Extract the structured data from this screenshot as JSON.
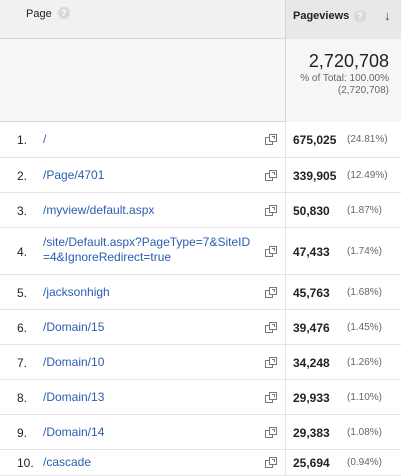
{
  "header": {
    "page_label": "Page",
    "pageviews_label": "Pageviews",
    "help_glyph": "?",
    "sort_glyph": "↓"
  },
  "totals": {
    "value": "2,720,708",
    "pct_of_total": "% of Total: 100.00%",
    "abs": "(2,720,708)"
  },
  "rows": [
    {
      "rank": "1.",
      "page": "/",
      "pageviews": "675,025",
      "pct": "(24.81%)"
    },
    {
      "rank": "2.",
      "page": "/Page/4701",
      "pageviews": "339,905",
      "pct": "(12.49%)"
    },
    {
      "rank": "3.",
      "page": "/myview/default.aspx",
      "pageviews": "50,830",
      "pct": "(1.87%)"
    },
    {
      "rank": "4.",
      "page": "/site/Default.aspx?PageType=7&SiteID=4&IgnoreRedirect=true",
      "pageviews": "47,433",
      "pct": "(1.74%)"
    },
    {
      "rank": "5.",
      "page": "/jacksonhigh",
      "pageviews": "45,763",
      "pct": "(1.68%)"
    },
    {
      "rank": "6.",
      "page": "/Domain/15",
      "pageviews": "39,476",
      "pct": "(1.45%)"
    },
    {
      "rank": "7.",
      "page": "/Domain/10",
      "pageviews": "34,248",
      "pct": "(1.26%)"
    },
    {
      "rank": "8.",
      "page": "/Domain/13",
      "pageviews": "29,933",
      "pct": "(1.10%)"
    },
    {
      "rank": "9.",
      "page": "/Domain/14",
      "pageviews": "29,383",
      "pct": "(1.08%)"
    },
    {
      "rank": "10.",
      "page": "/cascade",
      "pageviews": "25,694",
      "pct": "(0.94%)"
    }
  ]
}
